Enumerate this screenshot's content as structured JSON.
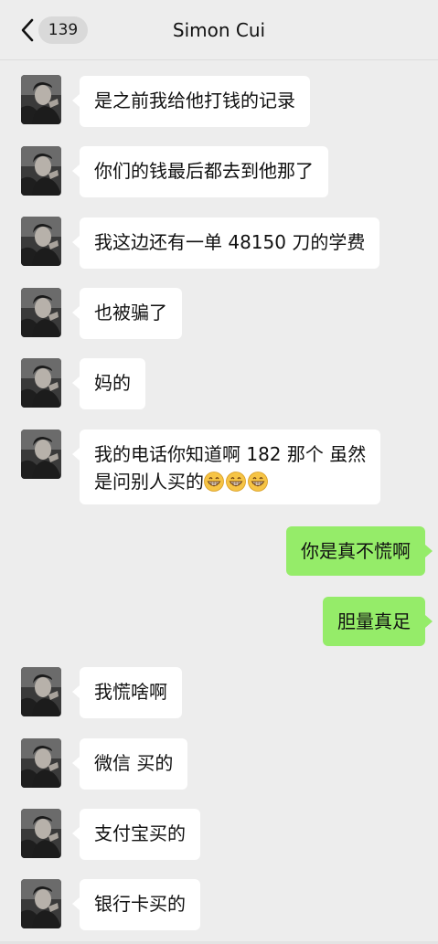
{
  "header": {
    "back_icon": "chevron-left-icon",
    "unread_count": "139",
    "title": "Simon Cui"
  },
  "messages": [
    {
      "side": "in",
      "text": "是之前我给他打钱的记录"
    },
    {
      "side": "in",
      "text": "你们的钱最后都去到他那了"
    },
    {
      "side": "in",
      "text": "我这边还有一单 48150 刀的学费"
    },
    {
      "side": "in",
      "text": "也被骗了"
    },
    {
      "side": "in",
      "text": "妈的"
    },
    {
      "side": "in",
      "line1": "我的电话你知道啊 182 那个  虽然",
      "line2": "是问别人买的",
      "emoji": "grinning-face-icon"
    },
    {
      "side": "out",
      "text": "你是真不慌啊"
    },
    {
      "side": "out",
      "text": "胆量真足"
    },
    {
      "side": "in",
      "text": "我慌啥啊"
    },
    {
      "side": "in",
      "text": "微信 买的"
    },
    {
      "side": "in",
      "text": "支付宝买的"
    },
    {
      "side": "in",
      "text": "银行卡买的"
    }
  ],
  "colors": {
    "background": "#ededed",
    "incoming_bubble": "#ffffff",
    "outgoing_bubble": "#95ec69"
  }
}
